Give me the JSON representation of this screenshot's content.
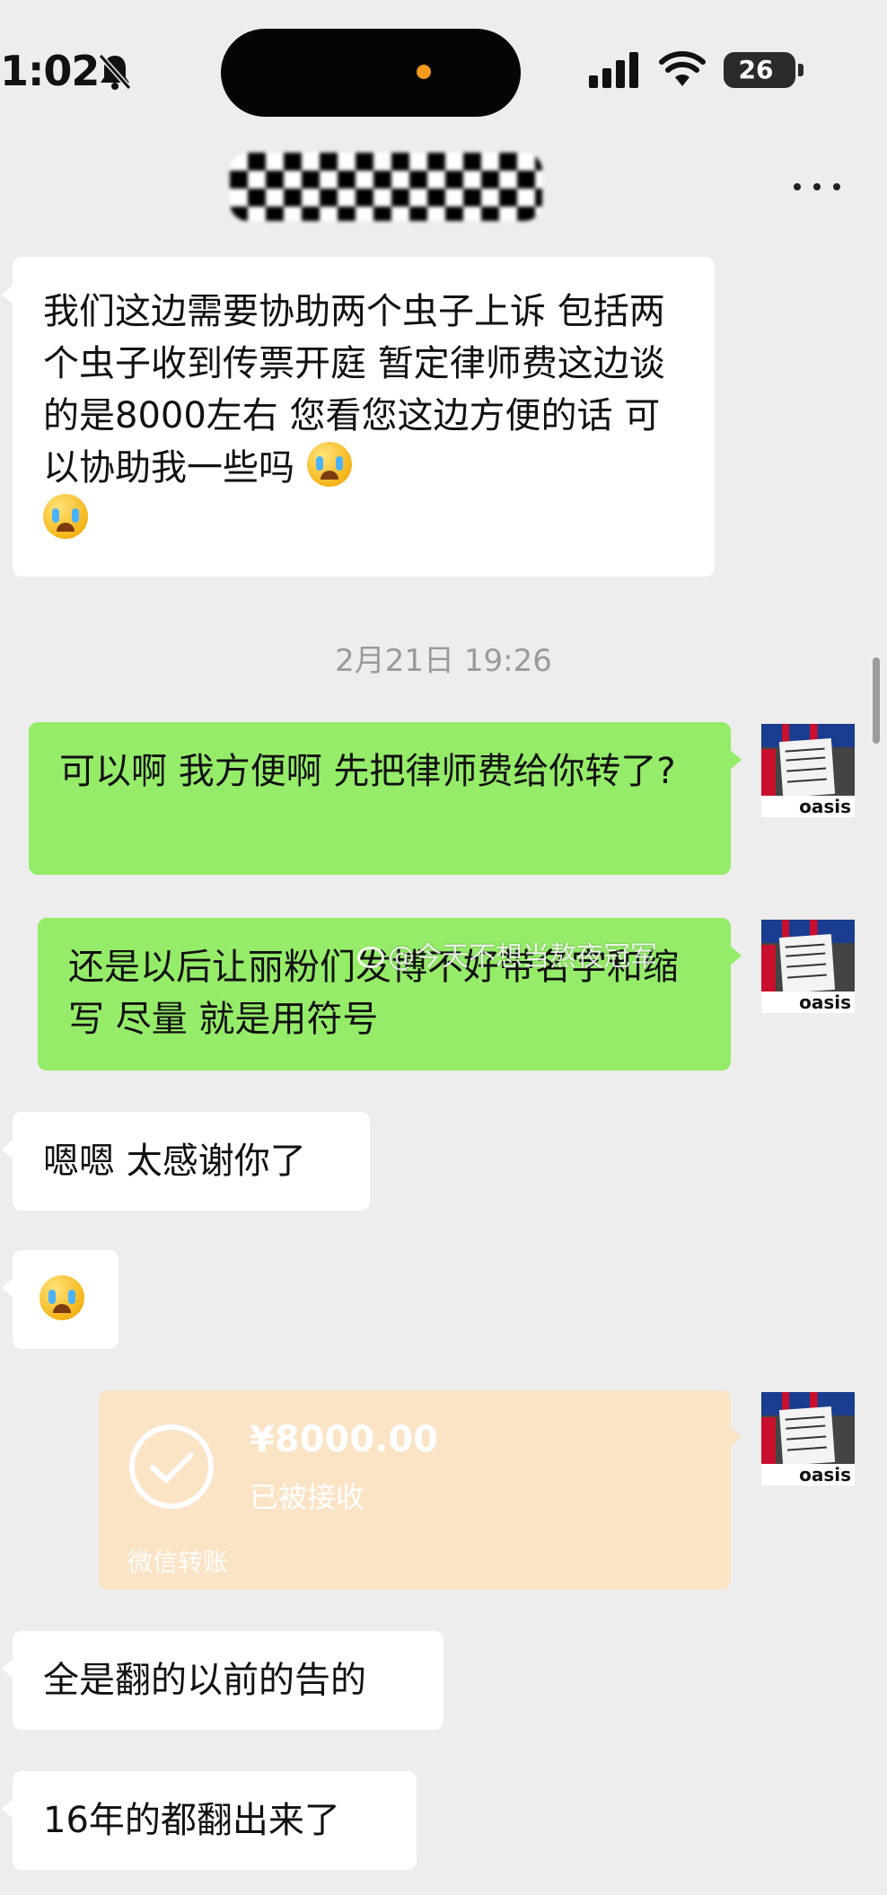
{
  "status_bar": {
    "time": "1:02",
    "battery": "26"
  },
  "watermark": "@今天不想当熬夜冠军",
  "messages": [
    {
      "text": "我们这边需要协助两个虫子上诉 包括两个虫子收到传票开庭  暂定律师费这边谈的是8000左右  您看您这边方便的话 可以协助我一些吗"
    },
    {
      "text": "可以啊 我方便啊 先把律师费给你转了?"
    },
    {
      "text": "还是以后让丽粉们发博不好带名字和缩写 尽量 就是用符号"
    },
    {
      "text": "嗯嗯 太感谢你了"
    },
    {
      "text": "全是翻的以前的告的"
    },
    {
      "text": "16年的都翻出来了"
    }
  ],
  "timestamp": "2月21日 19:26",
  "transfer": {
    "amount": "¥8000.00",
    "status": "已被接收",
    "footer": "微信转账"
  },
  "avatar": {
    "logo": "oasis"
  },
  "colors": {
    "background": "#ededed",
    "outgoing": "#95ec69",
    "incoming": "#ffffff",
    "transfer": "#fbe3c6"
  }
}
